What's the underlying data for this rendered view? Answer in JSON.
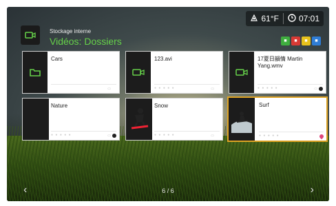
{
  "status": {
    "temperature": "61°F",
    "time": "07:01",
    "weather_icon": "weather-icon",
    "clock_icon": "clock-icon"
  },
  "header": {
    "source": "Stockage interne",
    "title": "Vidéos: Dossiers"
  },
  "color_buttons": [
    {
      "name": "green-button",
      "color": "#3fae3f",
      "glyph": "■"
    },
    {
      "name": "red-button",
      "color": "#d83a35",
      "glyph": "■"
    },
    {
      "name": "yellow-button",
      "color": "#e7c21c",
      "glyph": "■"
    },
    {
      "name": "blue-button",
      "color": "#2f7dd6",
      "glyph": "■"
    }
  ],
  "tiles": [
    {
      "label": "Cars",
      "type": "folder"
    },
    {
      "label": "123.avi",
      "type": "video"
    },
    {
      "label": "17夏日韻情 Martin Yang.wmv",
      "type": "video"
    },
    {
      "label": "Nature",
      "type": "photo"
    },
    {
      "label": "Snow",
      "type": "photo"
    },
    {
      "label": "Surf",
      "type": "photo",
      "selected": true
    }
  ],
  "pagination": "6 / 6",
  "accent_color": "#66d24a",
  "selection_color": "#e0a424"
}
